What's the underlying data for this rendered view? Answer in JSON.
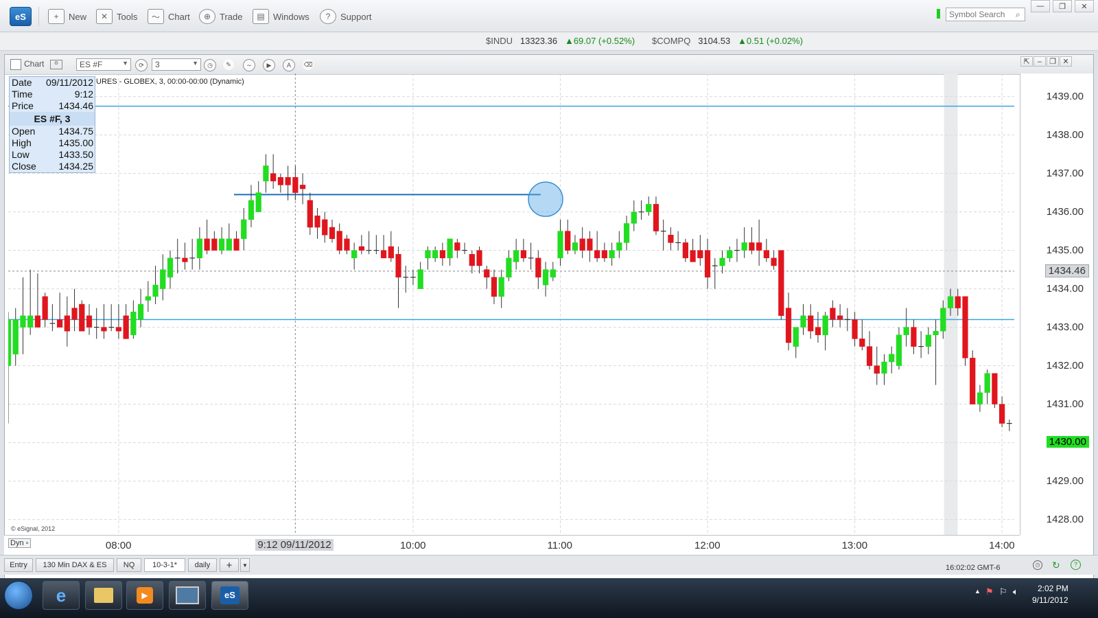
{
  "app": {
    "logo": "eS",
    "menu": [
      "New",
      "Tools",
      "Chart",
      "Trade",
      "Windows",
      "Support"
    ],
    "symbol_search_placeholder": "Symbol Search",
    "window_controls": [
      "—",
      "❐",
      "✕"
    ]
  },
  "ticker": {
    "items": [
      {
        "symbol": "$INDU",
        "value": "13323.36",
        "change": "69.07 (+0.52%)"
      },
      {
        "symbol": "$COMPQ",
        "value": "3104.53",
        "change": "0.51 (+0.02%)"
      }
    ]
  },
  "chart_window": {
    "title": "Chart",
    "symbol": "ES #F",
    "interval": "3",
    "description": "URES - GLOBEX, 3, 00:00-00:00 (Dynamic)",
    "copyright": "© eSignal, 2012",
    "dyn_label": "Dyn"
  },
  "info_panel": {
    "date_label": "Date",
    "date": "09/11/2012",
    "time_label": "Time",
    "time": "9:12",
    "price_label": "Price",
    "price": "1434.46",
    "header": "ES #F, 3",
    "open_label": "Open",
    "open": "1434.75",
    "high_label": "High",
    "high": "1435.00",
    "low_label": "Low",
    "low": "1433.50",
    "close_label": "Close",
    "close": "1434.25"
  },
  "price_axis": {
    "labels": [
      "1439.00",
      "1438.00",
      "1437.00",
      "1436.00",
      "1435.00",
      "1434.00",
      "1433.00",
      "1432.00",
      "1431.00",
      "1430.00",
      "1429.00",
      "1428.00"
    ],
    "cursor_label": "1434.46",
    "last_label": "1430.00"
  },
  "time_axis": {
    "labels": [
      "08:00",
      "10:00",
      "11:00",
      "12:00",
      "13:00",
      "14:00"
    ],
    "cursor_label": "9:12 09/11/2012"
  },
  "tabs": [
    "Entry",
    "130 Min DAX & ES",
    "NQ",
    "10-3-1*",
    "daily",
    "+"
  ],
  "active_tab": "10-3-1*",
  "status_clock": "16:02:02 GMT-6",
  "taskbar": {
    "time": "2:02 PM",
    "date": "9/11/2012"
  },
  "colors": {
    "up": "#22dd22",
    "down": "#e0161e",
    "hline": "#3aa6e0",
    "accent": "#1a5ea8"
  },
  "chart_data": {
    "type": "candlestick",
    "symbol": "ES #F",
    "interval_minutes": 3,
    "y_range": [
      1427.6,
      1439.6
    ],
    "x_range": [
      "07:15",
      "14:05"
    ],
    "horizontal_lines": [
      1438.75,
      1433.2
    ],
    "ray": {
      "from": "08:47",
      "to": "10:52",
      "price": 1436.45
    },
    "candles": [
      {
        "t": "07:15",
        "o": 1432.0,
        "h": 1433.4,
        "l": 1430.5,
        "c": 1433.2
      },
      {
        "t": "07:18",
        "o": 1432.3,
        "h": 1433.5,
        "l": 1432.0,
        "c": 1433.2
      },
      {
        "t": "07:21",
        "o": 1433.0,
        "h": 1434.3,
        "l": 1432.3,
        "c": 1433.3
      },
      {
        "t": "07:24",
        "o": 1433.0,
        "h": 1434.5,
        "l": 1432.8,
        "c": 1433.3
      },
      {
        "t": "07:27",
        "o": 1433.3,
        "h": 1434.4,
        "l": 1433.0,
        "c": 1433.0
      },
      {
        "t": "07:30",
        "o": 1433.8,
        "h": 1433.9,
        "l": 1433.0,
        "c": 1433.2
      },
      {
        "t": "07:33",
        "o": 1433.1,
        "h": 1433.6,
        "l": 1432.9,
        "c": 1433.1
      },
      {
        "t": "07:36",
        "o": 1433.2,
        "h": 1433.9,
        "l": 1433.0,
        "c": 1433.0
      },
      {
        "t": "07:39",
        "o": 1433.3,
        "h": 1433.8,
        "l": 1432.5,
        "c": 1432.9
      },
      {
        "t": "07:42",
        "o": 1433.5,
        "h": 1434.0,
        "l": 1432.9,
        "c": 1433.2
      },
      {
        "t": "07:45",
        "o": 1433.6,
        "h": 1433.7,
        "l": 1433.0,
        "c": 1432.9
      },
      {
        "t": "07:48",
        "o": 1433.3,
        "h": 1433.6,
        "l": 1432.8,
        "c": 1433.0
      },
      {
        "t": "07:51",
        "o": 1433.0,
        "h": 1433.5,
        "l": 1432.7,
        "c": 1433.0
      },
      {
        "t": "07:54",
        "o": 1433.0,
        "h": 1433.6,
        "l": 1432.7,
        "c": 1432.9
      },
      {
        "t": "07:57",
        "o": 1433.0,
        "h": 1433.6,
        "l": 1432.9,
        "c": 1433.0
      },
      {
        "t": "08:00",
        "o": 1433.0,
        "h": 1433.6,
        "l": 1432.7,
        "c": 1432.9
      },
      {
        "t": "08:03",
        "o": 1433.3,
        "h": 1433.6,
        "l": 1432.7,
        "c": 1432.7
      },
      {
        "t": "08:06",
        "o": 1432.8,
        "h": 1433.7,
        "l": 1432.7,
        "c": 1433.4
      },
      {
        "t": "08:09",
        "o": 1433.2,
        "h": 1434.0,
        "l": 1433.0,
        "c": 1433.6
      },
      {
        "t": "08:12",
        "o": 1433.7,
        "h": 1434.2,
        "l": 1433.4,
        "c": 1433.8
      },
      {
        "t": "08:15",
        "o": 1433.8,
        "h": 1434.6,
        "l": 1433.6,
        "c": 1434.1
      },
      {
        "t": "08:18",
        "o": 1434.0,
        "h": 1434.9,
        "l": 1433.7,
        "c": 1434.5
      },
      {
        "t": "08:21",
        "o": 1434.3,
        "h": 1435.0,
        "l": 1434.0,
        "c": 1434.8
      },
      {
        "t": "08:24",
        "o": 1434.8,
        "h": 1435.3,
        "l": 1434.4,
        "c": 1434.8
      },
      {
        "t": "08:27",
        "o": 1434.8,
        "h": 1435.2,
        "l": 1434.5,
        "c": 1434.7
      },
      {
        "t": "08:30",
        "o": 1434.8,
        "h": 1435.3,
        "l": 1434.5,
        "c": 1434.8
      },
      {
        "t": "08:33",
        "o": 1434.8,
        "h": 1435.6,
        "l": 1434.5,
        "c": 1435.3
      },
      {
        "t": "08:36",
        "o": 1435.3,
        "h": 1435.8,
        "l": 1434.9,
        "c": 1435.0
      },
      {
        "t": "08:39",
        "o": 1435.3,
        "h": 1435.5,
        "l": 1435.0,
        "c": 1435.0
      },
      {
        "t": "08:42",
        "o": 1435.0,
        "h": 1435.6,
        "l": 1434.9,
        "c": 1435.3
      },
      {
        "t": "08:45",
        "o": 1435.0,
        "h": 1435.7,
        "l": 1435.0,
        "c": 1435.3
      },
      {
        "t": "08:48",
        "o": 1435.3,
        "h": 1435.5,
        "l": 1435.0,
        "c": 1435.0
      },
      {
        "t": "08:51",
        "o": 1435.3,
        "h": 1436.1,
        "l": 1435.0,
        "c": 1435.8
      },
      {
        "t": "08:54",
        "o": 1435.8,
        "h": 1436.7,
        "l": 1435.6,
        "c": 1436.3
      },
      {
        "t": "08:57",
        "o": 1436.0,
        "h": 1436.8,
        "l": 1436.0,
        "c": 1436.5
      },
      {
        "t": "09:00",
        "o": 1436.8,
        "h": 1437.5,
        "l": 1436.5,
        "c": 1437.2
      },
      {
        "t": "09:03",
        "o": 1437.0,
        "h": 1437.5,
        "l": 1436.6,
        "c": 1436.8
      },
      {
        "t": "09:06",
        "o": 1436.9,
        "h": 1437.0,
        "l": 1436.5,
        "c": 1436.7
      },
      {
        "t": "09:09",
        "o": 1436.9,
        "h": 1437.2,
        "l": 1436.3,
        "c": 1436.7
      },
      {
        "t": "09:12",
        "o": 1436.9,
        "h": 1437.2,
        "l": 1436.3,
        "c": 1436.5
      },
      {
        "t": "09:15",
        "o": 1436.7,
        "h": 1437.0,
        "l": 1436.2,
        "c": 1436.6
      },
      {
        "t": "09:18",
        "o": 1436.3,
        "h": 1436.5,
        "l": 1435.4,
        "c": 1435.6
      },
      {
        "t": "09:21",
        "o": 1435.9,
        "h": 1436.1,
        "l": 1435.3,
        "c": 1435.6
      },
      {
        "t": "09:24",
        "o": 1435.8,
        "h": 1436.0,
        "l": 1435.2,
        "c": 1435.4
      },
      {
        "t": "09:27",
        "o": 1435.6,
        "h": 1435.8,
        "l": 1435.2,
        "c": 1435.3
      },
      {
        "t": "09:30",
        "o": 1435.5,
        "h": 1435.7,
        "l": 1434.9,
        "c": 1435.0
      },
      {
        "t": "09:33",
        "o": 1435.3,
        "h": 1435.4,
        "l": 1434.9,
        "c": 1435.0
      },
      {
        "t": "09:36",
        "o": 1434.8,
        "h": 1435.2,
        "l": 1434.5,
        "c": 1435.0
      },
      {
        "t": "09:39",
        "o": 1435.1,
        "h": 1435.4,
        "l": 1434.9,
        "c": 1435.0
      },
      {
        "t": "09:42",
        "o": 1435.0,
        "h": 1435.5,
        "l": 1434.9,
        "c": 1435.0
      },
      {
        "t": "09:45",
        "o": 1435.0,
        "h": 1435.4,
        "l": 1434.9,
        "c": 1435.0
      },
      {
        "t": "09:48",
        "o": 1435.0,
        "h": 1435.4,
        "l": 1434.9,
        "c": 1434.8
      },
      {
        "t": "09:51",
        "o": 1435.1,
        "h": 1435.5,
        "l": 1434.7,
        "c": 1434.8
      },
      {
        "t": "09:54",
        "o": 1434.9,
        "h": 1435.1,
        "l": 1433.5,
        "c": 1434.3
      },
      {
        "t": "09:57",
        "o": 1434.3,
        "h": 1434.6,
        "l": 1433.9,
        "c": 1434.3
      },
      {
        "t": "10:00",
        "o": 1434.3,
        "h": 1434.5,
        "l": 1434.1,
        "c": 1434.3
      },
      {
        "t": "10:03",
        "o": 1434.0,
        "h": 1434.7,
        "l": 1434.0,
        "c": 1434.5
      },
      {
        "t": "10:06",
        "o": 1434.8,
        "h": 1435.1,
        "l": 1434.5,
        "c": 1435.0
      },
      {
        "t": "10:09",
        "o": 1434.8,
        "h": 1435.1,
        "l": 1434.7,
        "c": 1435.0
      },
      {
        "t": "10:12",
        "o": 1435.0,
        "h": 1435.2,
        "l": 1434.6,
        "c": 1434.8
      },
      {
        "t": "10:15",
        "o": 1434.8,
        "h": 1435.3,
        "l": 1434.6,
        "c": 1435.3
      },
      {
        "t": "10:18",
        "o": 1435.2,
        "h": 1435.3,
        "l": 1434.8,
        "c": 1435.0
      },
      {
        "t": "10:21",
        "o": 1435.0,
        "h": 1435.2,
        "l": 1434.9,
        "c": 1435.0
      },
      {
        "t": "10:24",
        "o": 1434.9,
        "h": 1435.0,
        "l": 1434.4,
        "c": 1434.6
      },
      {
        "t": "10:27",
        "o": 1435.0,
        "h": 1435.1,
        "l": 1434.4,
        "c": 1434.6
      },
      {
        "t": "10:30",
        "o": 1434.5,
        "h": 1434.6,
        "l": 1434.0,
        "c": 1434.3
      },
      {
        "t": "10:33",
        "o": 1434.3,
        "h": 1434.5,
        "l": 1433.6,
        "c": 1433.8
      },
      {
        "t": "10:36",
        "o": 1433.8,
        "h": 1434.5,
        "l": 1433.5,
        "c": 1434.3
      },
      {
        "t": "10:39",
        "o": 1434.3,
        "h": 1435.0,
        "l": 1434.2,
        "c": 1434.8
      },
      {
        "t": "10:42",
        "o": 1434.7,
        "h": 1435.3,
        "l": 1434.5,
        "c": 1435.0
      },
      {
        "t": "10:45",
        "o": 1435.0,
        "h": 1435.3,
        "l": 1434.7,
        "c": 1434.8
      },
      {
        "t": "10:48",
        "o": 1434.8,
        "h": 1435.2,
        "l": 1434.5,
        "c": 1434.8
      },
      {
        "t": "10:51",
        "o": 1434.8,
        "h": 1435.0,
        "l": 1434.0,
        "c": 1434.3
      },
      {
        "t": "10:54",
        "o": 1434.1,
        "h": 1434.7,
        "l": 1433.8,
        "c": 1434.5
      },
      {
        "t": "10:57",
        "o": 1434.3,
        "h": 1434.7,
        "l": 1434.2,
        "c": 1434.5
      },
      {
        "t": "11:00",
        "o": 1434.8,
        "h": 1435.8,
        "l": 1434.6,
        "c": 1435.5
      },
      {
        "t": "11:03",
        "o": 1435.5,
        "h": 1435.8,
        "l": 1434.9,
        "c": 1435.0
      },
      {
        "t": "11:06",
        "o": 1435.0,
        "h": 1435.4,
        "l": 1434.9,
        "c": 1435.2
      },
      {
        "t": "11:09",
        "o": 1435.3,
        "h": 1435.6,
        "l": 1434.8,
        "c": 1435.0
      },
      {
        "t": "11:12",
        "o": 1435.3,
        "h": 1435.5,
        "l": 1434.7,
        "c": 1435.0
      },
      {
        "t": "11:15",
        "o": 1435.0,
        "h": 1435.5,
        "l": 1434.7,
        "c": 1434.8
      },
      {
        "t": "11:18",
        "o": 1435.0,
        "h": 1435.2,
        "l": 1434.7,
        "c": 1434.8
      },
      {
        "t": "11:21",
        "o": 1434.8,
        "h": 1435.2,
        "l": 1434.6,
        "c": 1435.0
      },
      {
        "t": "11:24",
        "o": 1435.0,
        "h": 1435.5,
        "l": 1434.8,
        "c": 1435.2
      },
      {
        "t": "11:27",
        "o": 1435.2,
        "h": 1435.9,
        "l": 1435.0,
        "c": 1435.7
      },
      {
        "t": "11:30",
        "o": 1435.7,
        "h": 1436.3,
        "l": 1435.5,
        "c": 1436.0
      },
      {
        "t": "11:33",
        "o": 1436.0,
        "h": 1436.3,
        "l": 1435.8,
        "c": 1436.0
      },
      {
        "t": "11:36",
        "o": 1436.0,
        "h": 1436.4,
        "l": 1435.9,
        "c": 1436.2
      },
      {
        "t": "11:39",
        "o": 1436.2,
        "h": 1436.4,
        "l": 1435.4,
        "c": 1435.5
      },
      {
        "t": "11:42",
        "o": 1435.5,
        "h": 1435.8,
        "l": 1435.0,
        "c": 1435.5
      },
      {
        "t": "11:45",
        "o": 1435.4,
        "h": 1435.6,
        "l": 1435.0,
        "c": 1435.2
      },
      {
        "t": "11:48",
        "o": 1435.2,
        "h": 1435.5,
        "l": 1435.0,
        "c": 1435.2
      },
      {
        "t": "11:51",
        "o": 1435.2,
        "h": 1435.3,
        "l": 1434.7,
        "c": 1434.8
      },
      {
        "t": "11:54",
        "o": 1435.0,
        "h": 1435.3,
        "l": 1434.7,
        "c": 1434.7
      },
      {
        "t": "11:57",
        "o": 1435.0,
        "h": 1435.4,
        "l": 1434.6,
        "c": 1434.8
      },
      {
        "t": "12:00",
        "o": 1435.0,
        "h": 1435.3,
        "l": 1434.0,
        "c": 1434.3
      },
      {
        "t": "12:03",
        "o": 1434.6,
        "h": 1434.8,
        "l": 1434.0,
        "c": 1434.6
      },
      {
        "t": "12:06",
        "o": 1434.6,
        "h": 1435.0,
        "l": 1434.4,
        "c": 1434.8
      },
      {
        "t": "12:09",
        "o": 1434.8,
        "h": 1435.1,
        "l": 1434.7,
        "c": 1435.0
      },
      {
        "t": "12:12",
        "o": 1435.0,
        "h": 1435.3,
        "l": 1434.7,
        "c": 1435.0
      },
      {
        "t": "12:15",
        "o": 1435.0,
        "h": 1435.6,
        "l": 1434.8,
        "c": 1435.2
      },
      {
        "t": "12:18",
        "o": 1435.2,
        "h": 1435.6,
        "l": 1434.9,
        "c": 1435.0
      },
      {
        "t": "12:21",
        "o": 1435.2,
        "h": 1435.8,
        "l": 1434.6,
        "c": 1435.0
      },
      {
        "t": "12:24",
        "o": 1435.0,
        "h": 1435.3,
        "l": 1434.7,
        "c": 1434.8
      },
      {
        "t": "12:27",
        "o": 1434.8,
        "h": 1435.0,
        "l": 1434.5,
        "c": 1434.6
      },
      {
        "t": "12:30",
        "o": 1435.0,
        "h": 1435.0,
        "l": 1433.2,
        "c": 1433.3
      },
      {
        "t": "12:33",
        "o": 1433.5,
        "h": 1433.9,
        "l": 1432.4,
        "c": 1432.6
      },
      {
        "t": "12:36",
        "o": 1432.5,
        "h": 1433.0,
        "l": 1432.2,
        "c": 1433.0
      },
      {
        "t": "12:39",
        "o": 1433.0,
        "h": 1433.6,
        "l": 1432.8,
        "c": 1433.3
      },
      {
        "t": "12:42",
        "o": 1433.3,
        "h": 1433.6,
        "l": 1432.7,
        "c": 1432.9
      },
      {
        "t": "12:45",
        "o": 1433.0,
        "h": 1433.4,
        "l": 1432.6,
        "c": 1432.8
      },
      {
        "t": "12:48",
        "o": 1432.8,
        "h": 1433.4,
        "l": 1432.4,
        "c": 1433.3
      },
      {
        "t": "12:51",
        "o": 1433.5,
        "h": 1433.7,
        "l": 1433.0,
        "c": 1433.2
      },
      {
        "t": "12:54",
        "o": 1433.3,
        "h": 1433.6,
        "l": 1433.0,
        "c": 1433.2
      },
      {
        "t": "12:57",
        "o": 1433.2,
        "h": 1433.5,
        "l": 1432.9,
        "c": 1433.2
      },
      {
        "t": "13:00",
        "o": 1433.2,
        "h": 1433.4,
        "l": 1432.5,
        "c": 1432.7
      },
      {
        "t": "13:03",
        "o": 1432.7,
        "h": 1433.2,
        "l": 1432.4,
        "c": 1432.5
      },
      {
        "t": "13:06",
        "o": 1432.5,
        "h": 1432.9,
        "l": 1431.9,
        "c": 1432.0
      },
      {
        "t": "13:09",
        "o": 1432.0,
        "h": 1432.5,
        "l": 1431.5,
        "c": 1431.8
      },
      {
        "t": "13:12",
        "o": 1431.8,
        "h": 1432.3,
        "l": 1431.5,
        "c": 1432.1
      },
      {
        "t": "13:15",
        "o": 1432.1,
        "h": 1432.5,
        "l": 1431.8,
        "c": 1432.3
      },
      {
        "t": "13:18",
        "o": 1432.0,
        "h": 1433.0,
        "l": 1431.9,
        "c": 1432.8
      },
      {
        "t": "13:21",
        "o": 1432.8,
        "h": 1433.5,
        "l": 1432.5,
        "c": 1433.0
      },
      {
        "t": "13:24",
        "o": 1433.0,
        "h": 1433.2,
        "l": 1432.3,
        "c": 1432.5
      },
      {
        "t": "13:27",
        "o": 1432.5,
        "h": 1432.9,
        "l": 1432.2,
        "c": 1432.5
      },
      {
        "t": "13:30",
        "o": 1432.5,
        "h": 1433.0,
        "l": 1432.3,
        "c": 1432.8
      },
      {
        "t": "13:33",
        "o": 1432.8,
        "h": 1433.2,
        "l": 1431.5,
        "c": 1432.9
      },
      {
        "t": "13:36",
        "o": 1432.9,
        "h": 1433.7,
        "l": 1432.7,
        "c": 1433.5
      },
      {
        "t": "13:39",
        "o": 1433.5,
        "h": 1434.0,
        "l": 1433.3,
        "c": 1433.8
      },
      {
        "t": "13:42",
        "o": 1433.8,
        "h": 1434.0,
        "l": 1433.3,
        "c": 1433.5
      },
      {
        "t": "13:45",
        "o": 1433.8,
        "h": 1433.8,
        "l": 1432.0,
        "c": 1432.2
      },
      {
        "t": "13:48",
        "o": 1432.2,
        "h": 1432.4,
        "l": 1431.0,
        "c": 1431.0
      },
      {
        "t": "13:51",
        "o": 1431.0,
        "h": 1431.5,
        "l": 1430.8,
        "c": 1431.3
      },
      {
        "t": "13:54",
        "o": 1431.3,
        "h": 1431.9,
        "l": 1431.0,
        "c": 1431.8
      },
      {
        "t": "13:57",
        "o": 1431.8,
        "h": 1431.8,
        "l": 1430.9,
        "c": 1431.0
      },
      {
        "t": "14:00",
        "o": 1431.0,
        "h": 1431.2,
        "l": 1430.4,
        "c": 1430.5
      },
      {
        "t": "14:03",
        "o": 1430.5,
        "h": 1430.6,
        "l": 1430.3,
        "c": 1430.5
      }
    ]
  }
}
